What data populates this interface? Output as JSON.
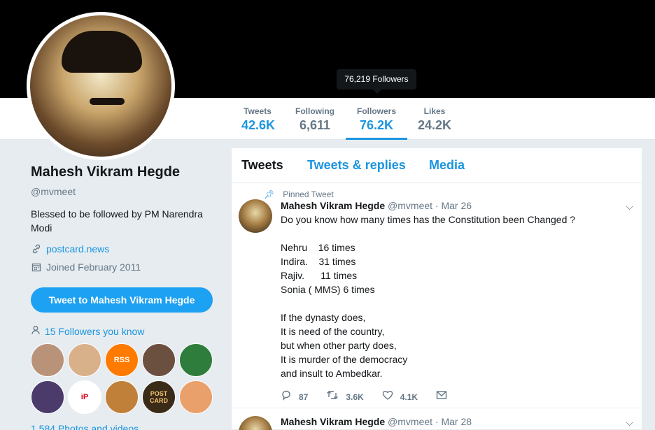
{
  "profile": {
    "name": "Mahesh Vikram Hegde",
    "handle": "@mvmeet",
    "bio": "Blessed to be followed by PM Narendra Modi",
    "website": "postcard.news",
    "joined": "Joined February 2011",
    "tweet_to_label": "Tweet to Mahesh Vikram Hegde",
    "followers_you_know": "15 Followers you know",
    "photos_label": "1,584 Photos and videos"
  },
  "stats": [
    {
      "label": "Tweets",
      "value": "42.6K"
    },
    {
      "label": "Following",
      "value": "6,611"
    },
    {
      "label": "Followers",
      "value": "76.2K"
    },
    {
      "label": "Likes",
      "value": "24.2K"
    }
  ],
  "tooltip": "76,219 Followers",
  "followers_known": [
    {
      "icon": "follower-avatar-1",
      "color": "#b89279",
      "text": ""
    },
    {
      "icon": "follower-avatar-2",
      "color": "#d8b08a",
      "text": ""
    },
    {
      "icon": "rss-logo",
      "color": "#ff7a00",
      "text": "RSS"
    },
    {
      "icon": "follower-avatar-4",
      "color": "#6b5040",
      "text": ""
    },
    {
      "icon": "follower-avatar-5",
      "color": "#2f7d3d",
      "text": ""
    },
    {
      "icon": "follower-avatar-6",
      "color": "#4a3b6b",
      "text": ""
    },
    {
      "icon": "ip-logo",
      "color": "#ffffff",
      "text": "iP"
    },
    {
      "icon": "follower-avatar-8",
      "color": "#c0803a",
      "text": ""
    },
    {
      "icon": "postcard-logo",
      "color": "#3a2a18",
      "text": "POST CARD"
    },
    {
      "icon": "follower-avatar-10",
      "color": "#e9a06a",
      "text": ""
    }
  ],
  "timeline": {
    "tabs": [
      "Tweets",
      "Tweets & replies",
      "Media"
    ],
    "tweets": [
      {
        "pinned_label": "Pinned Tweet",
        "author": "Mahesh Vikram Hegde",
        "handle": "@mvmeet",
        "date": "· Mar 26",
        "text": "Do you know how many times has the Constitution been Changed ?\n\nNehru    16 times\nIndira.    31 times\nRajiv.      11 times\nSonia ( MMS) 6 times\n\nIf the dynasty does,\nIt is need of the country,\nbut when other party does,\nIt is murder of the democracy\nand insult to Ambedkar.",
        "replies": "87",
        "retweets": "3.6K",
        "likes": "4.1K"
      },
      {
        "author": "Mahesh Vikram Hegde",
        "handle": "@mvmeet",
        "date": "· Mar 28"
      }
    ]
  }
}
